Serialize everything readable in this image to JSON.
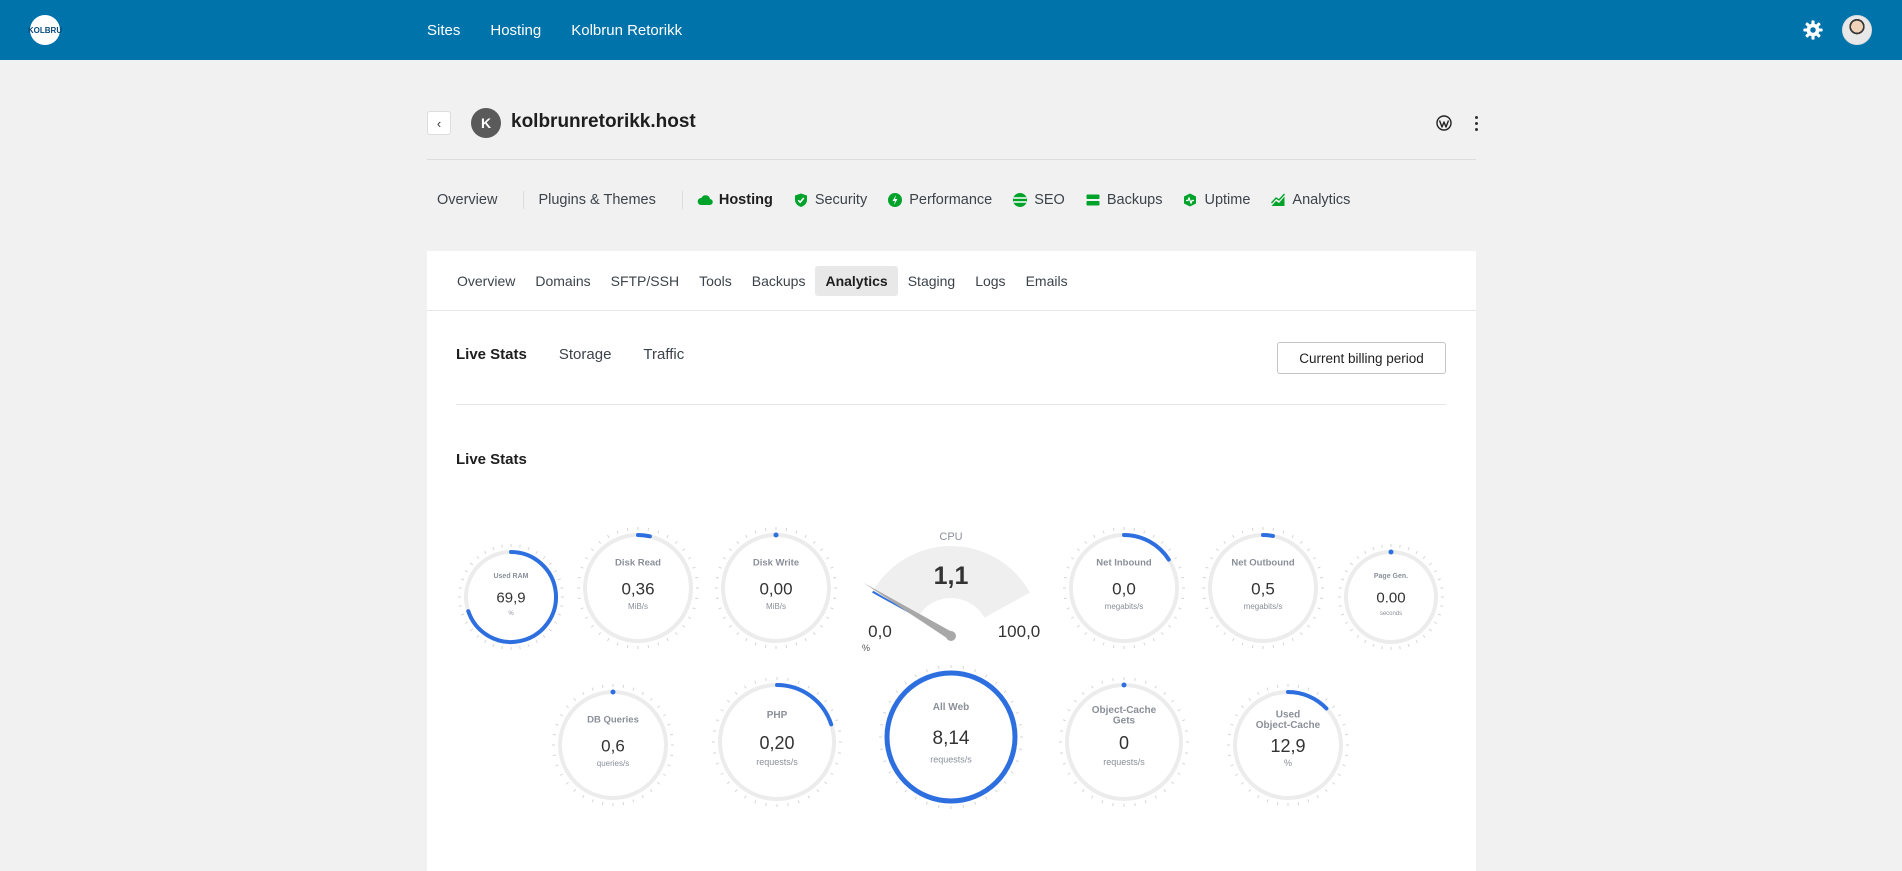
{
  "topbar": {
    "logo_text": "KOLBRU",
    "nav": [
      "Sites",
      "Hosting",
      "Kolbrun Retorikk"
    ],
    "settings_icon": "gear-icon",
    "avatar_icon": "user-avatar"
  },
  "site": {
    "avatar_letter": "K",
    "title": "kolbrunretorikk.host",
    "back_icon": "chevron-left-icon",
    "wp_icon": "wordpress-icon",
    "more_icon": "more-vertical-icon"
  },
  "site_tabs": [
    {
      "label": "Overview",
      "icon": null,
      "active": false
    },
    {
      "label": "Plugins & Themes",
      "icon": null,
      "active": false
    },
    {
      "label": "Hosting",
      "icon": "cloud-icon",
      "active": true
    },
    {
      "label": "Security",
      "icon": "shield-icon",
      "active": false
    },
    {
      "label": "Performance",
      "icon": "bolt-icon",
      "active": false
    },
    {
      "label": "SEO",
      "icon": "globe-icon",
      "active": false
    },
    {
      "label": "Backups",
      "icon": "server-icon",
      "active": false
    },
    {
      "label": "Uptime",
      "icon": "uptime-icon",
      "active": false
    },
    {
      "label": "Analytics",
      "icon": "chart-icon",
      "active": false
    }
  ],
  "hosting_tabs": [
    "Overview",
    "Domains",
    "SFTP/SSH",
    "Tools",
    "Backups",
    "Analytics",
    "Staging",
    "Logs",
    "Emails"
  ],
  "hosting_active": "Analytics",
  "stat_tabs": [
    "Live Stats",
    "Storage",
    "Traffic"
  ],
  "stat_active": "Live Stats",
  "billing_button": "Current billing period",
  "section_title": "Live Stats",
  "colors": {
    "accent": "#2e6fe0",
    "track": "#ececec",
    "topbar": "#0073aa",
    "green": "#00a32a"
  },
  "gauges": [
    {
      "label": "Used RAM",
      "value": "69,9",
      "unit": "%",
      "fraction": 0.699,
      "size": "s"
    },
    {
      "label": "Disk Read",
      "value": "0,36",
      "unit": "MiB/s",
      "fraction": 0.036,
      "size": "m"
    },
    {
      "label": "Disk Write",
      "value": "0,00",
      "unit": "MiB/s",
      "fraction": 0.0,
      "size": "m"
    },
    {
      "label": "Net Inbound",
      "value": "0,0",
      "unit": "megabits/s",
      "fraction": 0.16,
      "size": "m"
    },
    {
      "label": "Net Outbound",
      "value": "0,5",
      "unit": "megabits/s",
      "fraction": 0.03,
      "size": "m"
    },
    {
      "label": "Page Gen.",
      "value": "0.00",
      "unit": "seconds",
      "fraction": 0.0,
      "size": "s"
    },
    {
      "label": "DB Queries",
      "value": "0,6",
      "unit": "queries/s",
      "fraction": 0.0,
      "size": "m"
    },
    {
      "label": "PHP",
      "value": "0,20",
      "unit": "requests/s",
      "fraction": 0.2,
      "size": "l"
    },
    {
      "label": "All Web",
      "value": "8,14",
      "unit": "requests/s",
      "fraction": 1.0,
      "size": "xl"
    },
    {
      "label": "Object-Cache Gets",
      "value": "0",
      "unit": "requests/s",
      "fraction": 0.0,
      "size": "l"
    },
    {
      "label": "Used Object-Cache",
      "value": "12,9",
      "unit": "%",
      "fraction": 0.129,
      "size": "l"
    }
  ],
  "cpu": {
    "label": "CPU",
    "value": "1,1",
    "min": "0,0",
    "max": "100,0",
    "unit": "%",
    "fraction": 0.011
  }
}
